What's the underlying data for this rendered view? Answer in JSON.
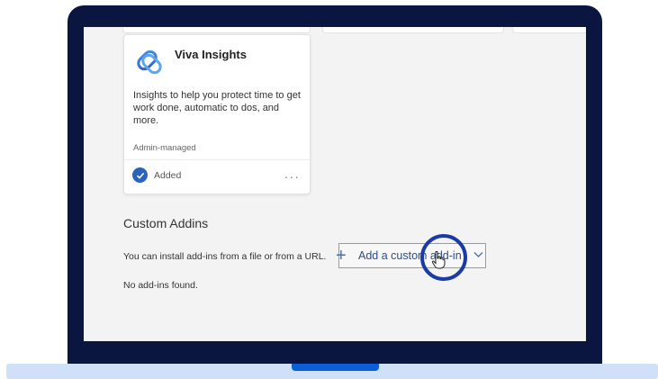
{
  "app_card": {
    "title": "Viva Insights",
    "description": "Insights to help you protect time to get work done, automatic to dos, and more.",
    "managed_label": "Admin-managed",
    "status_label": "Added",
    "more_label": "...",
    "logo_icon": "viva-insights-logo-icon",
    "check_icon": "checkmark-circle-icon"
  },
  "custom_addins": {
    "title": "Custom Addins",
    "install_text": "You can install add-ins from a file or from a URL.",
    "add_button_label": "Add a custom add-in",
    "plus_icon": "+",
    "empty_text": "No add-ins found."
  },
  "colors": {
    "laptop_frame": "#0b1640",
    "laptop_base": "#cfe0f8",
    "accent_blue": "#2b63b8",
    "highlight_ring": "#1a3aa6"
  }
}
